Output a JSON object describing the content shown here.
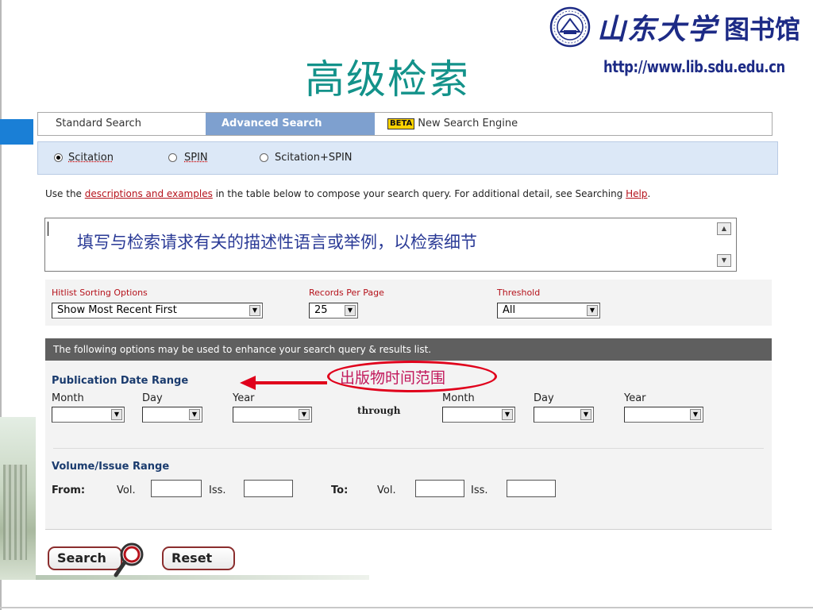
{
  "logo": {
    "seal_icon": "university-seal-icon",
    "name": "山东大学",
    "library": "图书馆",
    "url": "http://www.lib.sdu.edu.cn"
  },
  "page_title": "高级检索",
  "tabs": {
    "standard": "Standard Search",
    "advanced": "Advanced Search",
    "beta_badge": "BETA",
    "new_engine": "New Search Engine"
  },
  "databases": {
    "options": [
      "Scitation",
      "SPIN",
      "Scitation+SPIN"
    ],
    "selected": "Scitation"
  },
  "instructions": {
    "prefix": "Use the ",
    "link": "descriptions and examples",
    "middle": " in the table below to compose your search query. For additional detail, see Searching ",
    "help": "Help",
    "suffix": "."
  },
  "query": {
    "annotation": "填写与检索请求有关的描述性语言或举例，以检索细节"
  },
  "sorting": {
    "hitlist_label": "Hitlist Sorting Options",
    "hitlist_value": "Show Most Recent First",
    "records_label": "Records Per Page",
    "records_value": "25",
    "threshold_label": "Threshold",
    "threshold_value": "All"
  },
  "options_header": "The following options may be used to enhance your search query & results list.",
  "date_range": {
    "title": "Publication Date Range",
    "month": "Month",
    "day": "Day",
    "year": "Year",
    "through": "through",
    "annotation": "出版物时间范围"
  },
  "volume_range": {
    "title": "Volume/Issue Range",
    "from": "From:",
    "to": "To:",
    "vol": "Vol.",
    "iss": "Iss."
  },
  "buttons": {
    "search": "Search",
    "reset": "Reset"
  },
  "colors": {
    "title": "#13928a",
    "active_tab": "#7ea0cf",
    "annotation": "#e0001b",
    "label_red": "#b5121b"
  }
}
